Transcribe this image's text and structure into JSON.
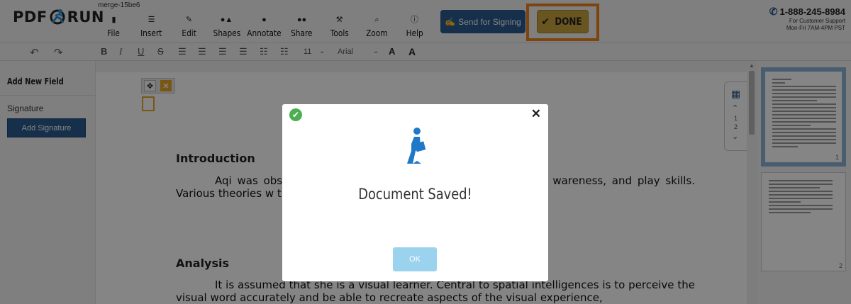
{
  "app": {
    "logo_left": "PDF",
    "logo_right": "RUN",
    "document_name": "merge-15be6"
  },
  "menu": [
    {
      "label": "File",
      "icon": "copy-icon"
    },
    {
      "label": "Insert",
      "icon": "list-icon"
    },
    {
      "label": "Edit",
      "icon": "pencil-icon"
    },
    {
      "label": "Shapes",
      "icon": "shapes-icon"
    },
    {
      "label": "Annotate",
      "icon": "comment-icon"
    },
    {
      "label": "Share",
      "icon": "users-icon"
    },
    {
      "label": "Tools",
      "icon": "hammer-icon"
    },
    {
      "label": "Zoom",
      "icon": "search-icon"
    },
    {
      "label": "Help",
      "icon": "info-icon"
    }
  ],
  "actions": {
    "send_for_signing": "Send for Signing",
    "done": "DONE"
  },
  "support": {
    "phone": "1-888-245-8984",
    "line1": "For Customer Support",
    "line2": "Mon-Fri 7AM-4PM PST"
  },
  "format": {
    "font_size": "11",
    "font_family": "Arial"
  },
  "sidebar": {
    "title": "Add New Field",
    "signature_label": "Signature",
    "add_signature": "Add Signature"
  },
  "document": {
    "heading1": "Introduction",
    "para1": "Aqi was obs                                                    yzed in terms of self-help, cognitive, language                                              wareness, and play skills. Various theories w                                          t to further explain Aqi’s development.",
    "heading2": "Analysis",
    "para2": "It is assumed that she is a visual learner.  Central to spatial intelligences is to perceive the visual word accurately and be able to recreate aspects of the visual experience,"
  },
  "page_nav": {
    "page1": "1",
    "page2": "2"
  },
  "thumbnails": [
    {
      "number": "1"
    },
    {
      "number": "2"
    }
  ],
  "modal": {
    "title": "Document Saved!",
    "ok": "OK"
  },
  "colors": {
    "primary": "#2b5a8e",
    "done": "#c9a33c",
    "highlight": "#f08219",
    "success": "#4caf50",
    "ok_button": "#9bd3ef"
  }
}
